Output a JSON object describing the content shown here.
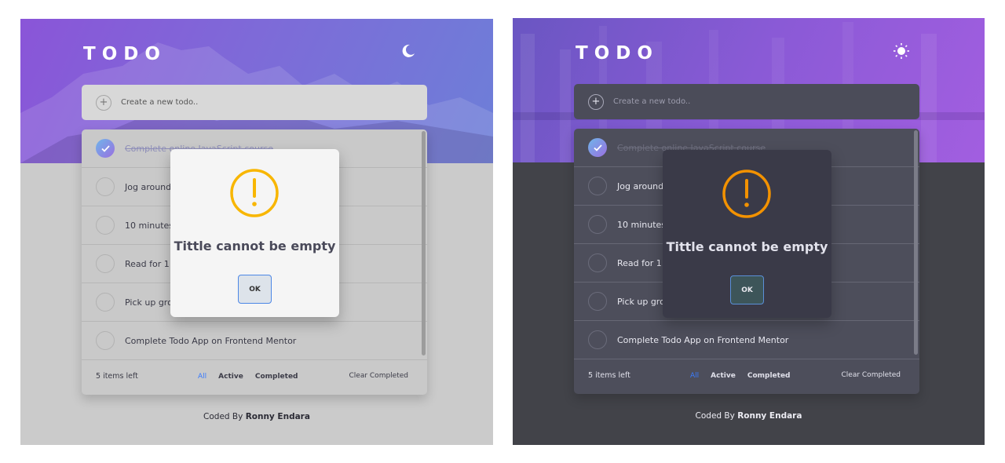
{
  "app": {
    "title": "TODO"
  },
  "input": {
    "placeholder": "Create a new todo.."
  },
  "todos": [
    {
      "text": "Complete online JavaScript course",
      "completed": true
    },
    {
      "text": "Jog around",
      "completed": false
    },
    {
      "text": "10 minutes",
      "completed": false
    },
    {
      "text": "Read for 1",
      "completed": false
    },
    {
      "text": "Pick up gro",
      "completed": false
    },
    {
      "text": "Complete Todo App on Frontend Mentor",
      "completed": false
    }
  ],
  "footer": {
    "items_left": "5 items left",
    "filter_all": "All",
    "filter_active": "Active",
    "filter_completed": "Completed",
    "clear": "Clear Completed"
  },
  "credit": {
    "prefix": "Coded By",
    "author": "Ronny Endara"
  },
  "modal": {
    "message": "Tittle cannot be empty",
    "button": "OK"
  },
  "icons": {
    "light_theme_toggle": "moon-icon",
    "dark_theme_toggle": "sun-icon",
    "modal": "warning-icon",
    "completed_check": "checkmark-icon"
  },
  "colors": {
    "accent": "#3a7bfd",
    "warning_light": "#f8b600",
    "warning_dark": "#f39200",
    "check_gradient_start": "#6fb5ea",
    "check_gradient_end": "#9a6fe0"
  }
}
